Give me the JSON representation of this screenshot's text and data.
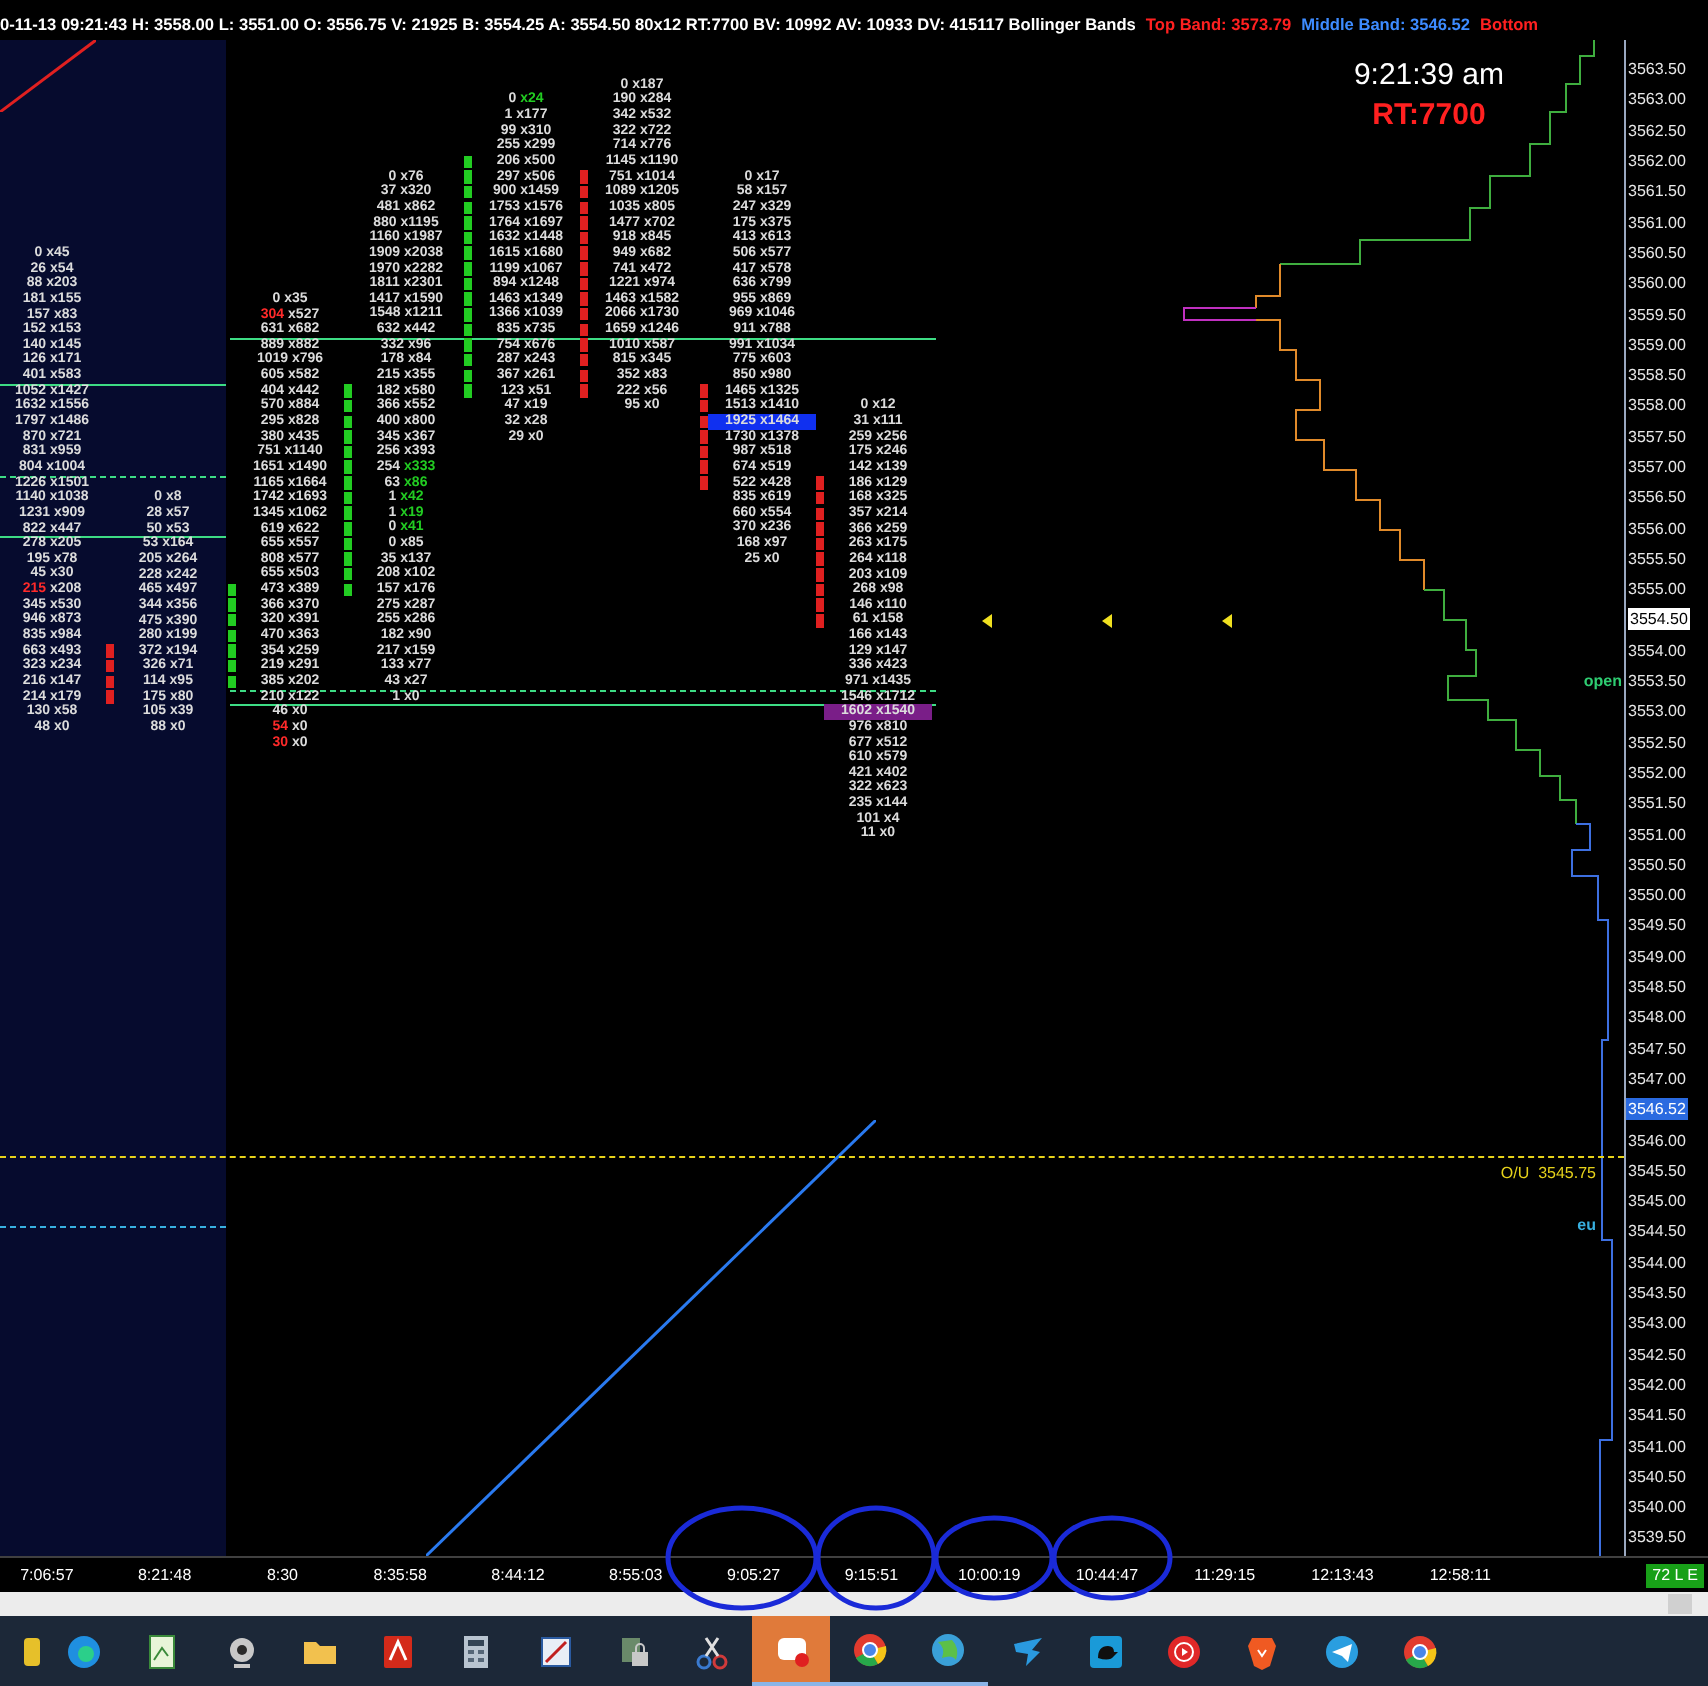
{
  "header": {
    "status": "0-11-13 09:21:43 H: 3558.00 L: 3551.00 O: 3556.75 V: 21925 B: 3554.25 A: 3554.50 80x12 RT:7700 BV: 10992 AV: 10933 DV: 415117 Bollinger Bands",
    "bands": [
      {
        "text": "Top Band: 3573.79",
        "color": "#ff2020"
      },
      {
        "text": "Middle Band: 3546.52",
        "color": "#3d8bff"
      },
      {
        "text": "Bottom",
        "color": "#ff2020"
      }
    ]
  },
  "clock": "9:21:39 am",
  "rt": "RT:7700",
  "footprint": {
    "columns": [
      {
        "rows": [
          {
            "bid": "0",
            "ask": "x45",
            "kind": "plain",
            "bar": false
          },
          {
            "bid": "26",
            "ask": "x54",
            "kind": "plain",
            "bar": false
          },
          {
            "bid": "88",
            "ask": "x203",
            "kind": "plain",
            "bar": false
          },
          {
            "bid": "181",
            "ask": "x155",
            "kind": "plain",
            "bar": false
          },
          {
            "bid": "157",
            "ask": "x83",
            "kind": "plain",
            "bar": false
          },
          {
            "bid": "152",
            "ask": "x153",
            "kind": "plain",
            "bar": false
          },
          {
            "bid": "140",
            "ask": "x145",
            "kind": "plain",
            "bar": false
          },
          {
            "bid": "126",
            "ask": "x171",
            "kind": "plain",
            "bar": false
          },
          {
            "bid": "401",
            "ask": "x583",
            "kind": "plain",
            "bar": false
          },
          {
            "bid": "1052",
            "ask": "x1427",
            "kind": "plain",
            "bar": false
          },
          {
            "bid": "1632",
            "ask": "x1556",
            "kind": "plain",
            "bar": false
          },
          {
            "bid": "1797",
            "ask": "x1486",
            "kind": "plain",
            "bar": false
          },
          {
            "bid": "870",
            "ask": "x721",
            "kind": "plain",
            "bar": false
          },
          {
            "bid": "831",
            "ask": "x959",
            "kind": "plain",
            "bar": false
          },
          {
            "bid": "804",
            "ask": "x1004",
            "kind": "plain",
            "bar": false
          },
          {
            "bid": "1226",
            "ask": "x1501",
            "kind": "plain",
            "bar": false
          },
          {
            "bid": "1140",
            "ask": "x1038",
            "kind": "plain",
            "bar": false
          },
          {
            "bid": "1231",
            "ask": "x909",
            "kind": "plain",
            "bar": false
          },
          {
            "bid": "822",
            "ask": "x447",
            "kind": "plain",
            "bar": false
          },
          {
            "bid": "278",
            "ask": "x205",
            "kind": "plain",
            "bar": false
          },
          {
            "bid": "195",
            "ask": "x78",
            "kind": "plain",
            "bar": false
          },
          {
            "bid": "45",
            "ask": "x30",
            "kind": "plain",
            "bar": false
          },
          {
            "bid": "215",
            "ask": "x208",
            "kind": "red-bid",
            "bar": false
          },
          {
            "bid": "345",
            "ask": "x530",
            "kind": "plain",
            "bar": false
          },
          {
            "bid": "946",
            "ask": "x873",
            "kind": "plain",
            "bar": false
          },
          {
            "bid": "835",
            "ask": "x984",
            "kind": "plain",
            "bar": false
          },
          {
            "bid": "663",
            "ask": "x493",
            "kind": "plain",
            "bar": false
          },
          {
            "bid": "323",
            "ask": "x234",
            "kind": "plain",
            "bar": false
          },
          {
            "bid": "216",
            "ask": "x147",
            "kind": "plain",
            "bar": false
          },
          {
            "bid": "214",
            "ask": "x179",
            "kind": "plain",
            "bar": false
          },
          {
            "bid": "130",
            "ask": "x58",
            "kind": "plain",
            "bar": false
          },
          {
            "bid": "48",
            "ask": "x0",
            "kind": "plain",
            "bar": false
          }
        ]
      },
      {
        "color": "#e02020",
        "rows": [
          {
            "bid": "0",
            "ask": "x8",
            "kind": "plain",
            "bar": false
          },
          {
            "bid": "28",
            "ask": "x57",
            "kind": "plain",
            "bar": false
          },
          {
            "bid": "50",
            "ask": "x53",
            "kind": "plain",
            "bar": false
          },
          {
            "bid": "53",
            "ask": "x164",
            "kind": "plain",
            "bar": false
          },
          {
            "bid": "205",
            "ask": "x264",
            "kind": "plain",
            "bar": false
          },
          {
            "bid": "228",
            "ask": "x242",
            "kind": "plain",
            "bar": false
          },
          {
            "bid": "465",
            "ask": "x497",
            "kind": "plain",
            "bar": false
          },
          {
            "bid": "344",
            "ask": "x356",
            "kind": "plain",
            "bar": false
          },
          {
            "bid": "475",
            "ask": "x390",
            "kind": "plain",
            "bar": false
          },
          {
            "bid": "280",
            "ask": "x199",
            "kind": "plain",
            "bar": false
          },
          {
            "bid": "372",
            "ask": "x194",
            "kind": "plain",
            "bar": true
          },
          {
            "bid": "326",
            "ask": "x71",
            "kind": "plain",
            "bar": true
          },
          {
            "bid": "114",
            "ask": "x95",
            "kind": "plain",
            "bar": true
          },
          {
            "bid": "175",
            "ask": "x80",
            "kind": "plain",
            "bar": true
          },
          {
            "bid": "105",
            "ask": "x39",
            "kind": "plain",
            "bar": false
          },
          {
            "bid": "88",
            "ask": "x0",
            "kind": "plain",
            "bar": false
          }
        ]
      },
      {
        "color": "#22cc22",
        "rows": [
          {
            "bid": "0",
            "ask": "x35",
            "kind": "plain",
            "bar": false
          },
          {
            "bid": "304",
            "ask": "x527",
            "kind": "red-bid",
            "bar": false
          },
          {
            "bid": "631",
            "ask": "x682",
            "kind": "plain",
            "bar": false
          },
          {
            "bid": "889",
            "ask": "x882",
            "kind": "plain",
            "bar": false
          },
          {
            "bid": "1019",
            "ask": "x796",
            "kind": "plain",
            "bar": false
          },
          {
            "bid": "605",
            "ask": "x582",
            "kind": "plain",
            "bar": false
          },
          {
            "bid": "404",
            "ask": "x442",
            "kind": "plain",
            "bar": false
          },
          {
            "bid": "570",
            "ask": "x884",
            "kind": "plain",
            "bar": false
          },
          {
            "bid": "295",
            "ask": "x828",
            "kind": "plain",
            "bar": false
          },
          {
            "bid": "380",
            "ask": "x435",
            "kind": "plain",
            "bar": false
          },
          {
            "bid": "751",
            "ask": "x1140",
            "kind": "plain",
            "bar": false
          },
          {
            "bid": "1651",
            "ask": "x1490",
            "kind": "plain",
            "bar": false
          },
          {
            "bid": "1165",
            "ask": "x1664",
            "kind": "plain",
            "bar": false
          },
          {
            "bid": "1742",
            "ask": "x1693",
            "kind": "plain",
            "bar": false
          },
          {
            "bid": "1345",
            "ask": "x1062",
            "kind": "plain",
            "bar": false
          },
          {
            "bid": "619",
            "ask": "x622",
            "kind": "plain",
            "bar": false
          },
          {
            "bid": "655",
            "ask": "x557",
            "kind": "plain",
            "bar": false
          },
          {
            "bid": "808",
            "ask": "x577",
            "kind": "plain",
            "bar": false
          },
          {
            "bid": "655",
            "ask": "x503",
            "kind": "plain",
            "bar": false
          },
          {
            "bid": "473",
            "ask": "x389",
            "kind": "plain",
            "bar": true
          },
          {
            "bid": "366",
            "ask": "x370",
            "kind": "plain",
            "bar": true
          },
          {
            "bid": "320",
            "ask": "x391",
            "kind": "plain",
            "bar": true
          },
          {
            "bid": "470",
            "ask": "x363",
            "kind": "plain",
            "bar": true
          },
          {
            "bid": "354",
            "ask": "x259",
            "kind": "plain",
            "bar": true
          },
          {
            "bid": "219",
            "ask": "x291",
            "kind": "plain",
            "bar": true
          },
          {
            "bid": "385",
            "ask": "x202",
            "kind": "plain",
            "bar": true
          },
          {
            "bid": "210",
            "ask": "x122",
            "kind": "plain",
            "bar": false
          },
          {
            "bid": "46",
            "ask": "x0",
            "kind": "plain",
            "bar": false
          },
          {
            "bid": "54",
            "ask": "x0",
            "kind": "red-bid",
            "bar": false
          },
          {
            "bid": "30",
            "ask": "x0",
            "kind": "red-bid",
            "bar": false
          }
        ]
      },
      {
        "color": "#22cc22",
        "rows": [
          {
            "bid": "0",
            "ask": "x76",
            "kind": "plain",
            "bar": false
          },
          {
            "bid": "37",
            "ask": "x320",
            "kind": "plain",
            "bar": false
          },
          {
            "bid": "481",
            "ask": "x862",
            "kind": "plain",
            "bar": false
          },
          {
            "bid": "880",
            "ask": "x1195",
            "kind": "plain",
            "bar": false
          },
          {
            "bid": "1160",
            "ask": "x1987",
            "kind": "plain",
            "bar": false
          },
          {
            "bid": "1909",
            "ask": "x2038",
            "kind": "plain",
            "bar": false
          },
          {
            "bid": "1970",
            "ask": "x2282",
            "kind": "plain",
            "bar": false
          },
          {
            "bid": "1811",
            "ask": "x2301",
            "kind": "plain",
            "bar": false
          },
          {
            "bid": "1417",
            "ask": "x1590",
            "kind": "plain",
            "bar": false
          },
          {
            "bid": "1548",
            "ask": "x1211",
            "kind": "plain",
            "bar": false
          },
          {
            "bid": "632",
            "ask": "x442",
            "kind": "plain",
            "bar": false
          },
          {
            "bid": "332",
            "ask": "x96",
            "kind": "plain",
            "bar": false
          },
          {
            "bid": "178",
            "ask": "x84",
            "kind": "plain",
            "bar": false
          },
          {
            "bid": "215",
            "ask": "x355",
            "kind": "plain",
            "bar": false
          },
          {
            "bid": "182",
            "ask": "x580",
            "kind": "plain",
            "bar": true
          },
          {
            "bid": "366",
            "ask": "x552",
            "kind": "plain",
            "bar": true
          },
          {
            "bid": "400",
            "ask": "x800",
            "kind": "plain",
            "bar": true
          },
          {
            "bid": "345",
            "ask": "x367",
            "kind": "plain",
            "bar": true
          },
          {
            "bid": "256",
            "ask": "x393",
            "kind": "plain",
            "bar": true
          },
          {
            "bid": "254",
            "ask": "x333",
            "kind": "green-ask",
            "bar": true
          },
          {
            "bid": "63",
            "ask": "x86",
            "kind": "green-ask",
            "bar": true
          },
          {
            "bid": "1",
            "ask": "x42",
            "kind": "green-ask",
            "bar": true
          },
          {
            "bid": "1",
            "ask": "x19",
            "kind": "green-ask",
            "bar": true
          },
          {
            "bid": "0",
            "ask": "x41",
            "kind": "green-ask",
            "bar": true
          },
          {
            "bid": "0",
            "ask": "x85",
            "kind": "plain",
            "bar": true
          },
          {
            "bid": "35",
            "ask": "x137",
            "kind": "plain",
            "bar": true
          },
          {
            "bid": "208",
            "ask": "x102",
            "kind": "plain",
            "bar": true
          },
          {
            "bid": "157",
            "ask": "x176",
            "kind": "plain",
            "bar": true
          },
          {
            "bid": "275",
            "ask": "x287",
            "kind": "plain",
            "bar": false
          },
          {
            "bid": "255",
            "ask": "x286",
            "kind": "plain",
            "bar": false
          },
          {
            "bid": "182",
            "ask": "x90",
            "kind": "plain",
            "bar": false
          },
          {
            "bid": "217",
            "ask": "x159",
            "kind": "plain",
            "bar": false
          },
          {
            "bid": "133",
            "ask": "x77",
            "kind": "plain",
            "bar": false
          },
          {
            "bid": "43",
            "ask": "x27",
            "kind": "plain",
            "bar": false
          },
          {
            "bid": "1",
            "ask": "x0",
            "kind": "plain",
            "bar": false
          }
        ]
      },
      {
        "color": "#22cc22",
        "rows": [
          {
            "bid": "0",
            "ask": "x24",
            "kind": "green-ask",
            "bar": false
          },
          {
            "bid": "1",
            "ask": "x177",
            "kind": "plain",
            "bar": false
          },
          {
            "bid": "99",
            "ask": "x310",
            "kind": "plain",
            "bar": false
          },
          {
            "bid": "255",
            "ask": "x299",
            "kind": "plain",
            "bar": false
          },
          {
            "bid": "206",
            "ask": "x500",
            "kind": "plain",
            "bar": true
          },
          {
            "bid": "297",
            "ask": "x506",
            "kind": "plain",
            "bar": true
          },
          {
            "bid": "900",
            "ask": "x1459",
            "kind": "plain",
            "bar": true
          },
          {
            "bid": "1753",
            "ask": "x1576",
            "kind": "plain",
            "bar": true
          },
          {
            "bid": "1764",
            "ask": "x1697",
            "kind": "plain",
            "bar": true
          },
          {
            "bid": "1632",
            "ask": "x1448",
            "kind": "plain",
            "bar": true
          },
          {
            "bid": "1615",
            "ask": "x1680",
            "kind": "plain",
            "bar": true
          },
          {
            "bid": "1199",
            "ask": "x1067",
            "kind": "plain",
            "bar": true
          },
          {
            "bid": "894",
            "ask": "x1248",
            "kind": "plain",
            "bar": true
          },
          {
            "bid": "1463",
            "ask": "x1349",
            "kind": "plain",
            "bar": true
          },
          {
            "bid": "1366",
            "ask": "x1039",
            "kind": "plain",
            "bar": true
          },
          {
            "bid": "835",
            "ask": "x735",
            "kind": "plain",
            "bar": true
          },
          {
            "bid": "754",
            "ask": "x676",
            "kind": "plain",
            "bar": true
          },
          {
            "bid": "287",
            "ask": "x243",
            "kind": "plain",
            "bar": true
          },
          {
            "bid": "367",
            "ask": "x261",
            "kind": "plain",
            "bar": true
          },
          {
            "bid": "123",
            "ask": "x51",
            "kind": "plain",
            "bar": true
          },
          {
            "bid": "47",
            "ask": "x19",
            "kind": "plain",
            "bar": false
          },
          {
            "bid": "32",
            "ask": "x28",
            "kind": "plain",
            "bar": false
          },
          {
            "bid": "29",
            "ask": "x0",
            "kind": "plain",
            "bar": false
          }
        ]
      },
      {
        "color": "#e02020",
        "rows": [
          {
            "bid": "0",
            "ask": "x187",
            "kind": "plain",
            "bar": false
          },
          {
            "bid": "190",
            "ask": "x284",
            "kind": "plain",
            "bar": false
          },
          {
            "bid": "342",
            "ask": "x532",
            "kind": "plain",
            "bar": false
          },
          {
            "bid": "322",
            "ask": "x722",
            "kind": "plain",
            "bar": false
          },
          {
            "bid": "714",
            "ask": "x776",
            "kind": "plain",
            "bar": false
          },
          {
            "bid": "1145",
            "ask": "x1190",
            "kind": "plain",
            "bar": false
          },
          {
            "bid": "751",
            "ask": "x1014",
            "kind": "plain",
            "bar": true
          },
          {
            "bid": "1089",
            "ask": "x1205",
            "kind": "plain",
            "bar": true
          },
          {
            "bid": "1035",
            "ask": "x805",
            "kind": "plain",
            "bar": true
          },
          {
            "bid": "1477",
            "ask": "x702",
            "kind": "plain",
            "bar": true
          },
          {
            "bid": "918",
            "ask": "x845",
            "kind": "plain",
            "bar": true
          },
          {
            "bid": "949",
            "ask": "x682",
            "kind": "plain",
            "bar": true
          },
          {
            "bid": "741",
            "ask": "x472",
            "kind": "plain",
            "bar": true
          },
          {
            "bid": "1221",
            "ask": "x974",
            "kind": "plain",
            "bar": true
          },
          {
            "bid": "1463",
            "ask": "x1582",
            "kind": "plain",
            "bar": true
          },
          {
            "bid": "2066",
            "ask": "x1730",
            "kind": "plain",
            "bar": true
          },
          {
            "bid": "1659",
            "ask": "x1246",
            "kind": "plain",
            "bar": true
          },
          {
            "bid": "1010",
            "ask": "x587",
            "kind": "plain",
            "bar": true
          },
          {
            "bid": "815",
            "ask": "x345",
            "kind": "plain",
            "bar": true
          },
          {
            "bid": "352",
            "ask": "x83",
            "kind": "plain",
            "bar": true
          },
          {
            "bid": "222",
            "ask": "x56",
            "kind": "plain",
            "bar": true
          },
          {
            "bid": "95",
            "ask": "x0",
            "kind": "plain",
            "bar": false
          }
        ]
      },
      {
        "color": "#e02020",
        "rows": [
          {
            "bid": "0",
            "ask": "x17",
            "kind": "plain",
            "bar": false
          },
          {
            "bid": "58",
            "ask": "x157",
            "kind": "plain",
            "bar": false
          },
          {
            "bid": "247",
            "ask": "x329",
            "kind": "plain",
            "bar": false
          },
          {
            "bid": "175",
            "ask": "x375",
            "kind": "plain",
            "bar": false
          },
          {
            "bid": "413",
            "ask": "x613",
            "kind": "plain",
            "bar": false
          },
          {
            "bid": "506",
            "ask": "x577",
            "kind": "plain",
            "bar": false
          },
          {
            "bid": "417",
            "ask": "x578",
            "kind": "plain",
            "bar": false
          },
          {
            "bid": "636",
            "ask": "x799",
            "kind": "plain",
            "bar": false
          },
          {
            "bid": "955",
            "ask": "x869",
            "kind": "plain",
            "bar": false
          },
          {
            "bid": "969",
            "ask": "x1046",
            "kind": "plain",
            "bar": false
          },
          {
            "bid": "911",
            "ask": "x788",
            "kind": "plain",
            "bar": false
          },
          {
            "bid": "991",
            "ask": "x1034",
            "kind": "plain",
            "bar": false
          },
          {
            "bid": "775",
            "ask": "x603",
            "kind": "plain",
            "bar": false
          },
          {
            "bid": "850",
            "ask": "x980",
            "kind": "plain",
            "bar": false
          },
          {
            "bid": "1465",
            "ask": "x1325",
            "kind": "plain",
            "bar": true
          },
          {
            "bid": "1513",
            "ask": "x1410",
            "kind": "plain",
            "bar": true
          },
          {
            "bid": "1925",
            "ask": "x1464",
            "kind": "blue",
            "bar": true
          },
          {
            "bid": "1730",
            "ask": "x1378",
            "kind": "plain",
            "bar": true
          },
          {
            "bid": "987",
            "ask": "x518",
            "kind": "plain",
            "bar": true
          },
          {
            "bid": "674",
            "ask": "x519",
            "kind": "plain",
            "bar": true
          },
          {
            "bid": "522",
            "ask": "x428",
            "kind": "plain",
            "bar": true
          },
          {
            "bid": "835",
            "ask": "x619",
            "kind": "plain",
            "bar": false
          },
          {
            "bid": "660",
            "ask": "x554",
            "kind": "plain",
            "bar": false
          },
          {
            "bid": "370",
            "ask": "x236",
            "kind": "plain",
            "bar": false
          },
          {
            "bid": "168",
            "ask": "x97",
            "kind": "plain",
            "bar": false
          },
          {
            "bid": "25",
            "ask": "x0",
            "kind": "plain",
            "bar": false
          }
        ]
      },
      {
        "color": "#e02020",
        "rows": [
          {
            "bid": "0",
            "ask": "x12",
            "kind": "plain",
            "bar": false
          },
          {
            "bid": "31",
            "ask": "x111",
            "kind": "plain",
            "bar": false
          },
          {
            "bid": "259",
            "ask": "x256",
            "kind": "plain",
            "bar": false
          },
          {
            "bid": "175",
            "ask": "x246",
            "kind": "plain",
            "bar": false
          },
          {
            "bid": "142",
            "ask": "x139",
            "kind": "plain",
            "bar": false
          },
          {
            "bid": "186",
            "ask": "x129",
            "kind": "plain",
            "bar": true
          },
          {
            "bid": "168",
            "ask": "x325",
            "kind": "plain",
            "bar": true
          },
          {
            "bid": "357",
            "ask": "x214",
            "kind": "plain",
            "bar": true
          },
          {
            "bid": "366",
            "ask": "x259",
            "kind": "plain",
            "bar": true
          },
          {
            "bid": "263",
            "ask": "x175",
            "kind": "plain",
            "bar": true
          },
          {
            "bid": "264",
            "ask": "x118",
            "kind": "plain",
            "bar": true
          },
          {
            "bid": "203",
            "ask": "x109",
            "kind": "plain",
            "bar": true
          },
          {
            "bid": "268",
            "ask": "x98",
            "kind": "plain",
            "bar": true
          },
          {
            "bid": "146",
            "ask": "x110",
            "kind": "plain",
            "bar": true
          },
          {
            "bid": "61",
            "ask": "x158",
            "kind": "plain",
            "bar": true
          },
          {
            "bid": "166",
            "ask": "x143",
            "kind": "plain",
            "bar": false
          },
          {
            "bid": "129",
            "ask": "x147",
            "kind": "plain",
            "bar": false
          },
          {
            "bid": "336",
            "ask": "x423",
            "kind": "plain",
            "bar": false
          },
          {
            "bid": "971",
            "ask": "x1435",
            "kind": "plain",
            "bar": false
          },
          {
            "bid": "1546",
            "ask": "x1712",
            "kind": "plain",
            "bar": false
          },
          {
            "bid": "1602",
            "ask": "x1540",
            "kind": "purple",
            "bar": false
          },
          {
            "bid": "976",
            "ask": "x810",
            "kind": "plain",
            "bar": false
          },
          {
            "bid": "677",
            "ask": "x512",
            "kind": "plain",
            "bar": false
          },
          {
            "bid": "610",
            "ask": "x579",
            "kind": "plain",
            "bar": false
          },
          {
            "bid": "421",
            "ask": "x402",
            "kind": "plain",
            "bar": false
          },
          {
            "bid": "322",
            "ask": "x623",
            "kind": "plain",
            "bar": false
          },
          {
            "bid": "235",
            "ask": "x144",
            "kind": "plain",
            "bar": false
          },
          {
            "bid": "101",
            "ask": "x4",
            "kind": "plain",
            "bar": false
          },
          {
            "bid": "11",
            "ask": "x0",
            "kind": "plain",
            "bar": false
          }
        ]
      }
    ]
  },
  "price_axis": [
    {
      "text": "3563.50",
      "kind": "tick"
    },
    {
      "text": "3563.00",
      "kind": "tick"
    },
    {
      "text": "3562.50",
      "kind": "tick"
    },
    {
      "text": "3562.00",
      "kind": "tick"
    },
    {
      "text": "3561.50",
      "kind": "tick"
    },
    {
      "text": "3561.00",
      "kind": "tick"
    },
    {
      "text": "3560.50",
      "kind": "tick"
    },
    {
      "text": "3560.00",
      "kind": "tick"
    },
    {
      "text": "3559.50",
      "kind": "tick"
    },
    {
      "text": "3559.00",
      "kind": "tick"
    },
    {
      "text": "3558.50",
      "kind": "tick"
    },
    {
      "text": "3558.00",
      "kind": "tick"
    },
    {
      "text": "3557.50",
      "kind": "tick"
    },
    {
      "text": "3557.00",
      "kind": "tick"
    },
    {
      "text": "3556.50",
      "kind": "tick"
    },
    {
      "text": "3556.00",
      "kind": "tick"
    },
    {
      "text": "3555.50",
      "kind": "tick"
    },
    {
      "text": "3555.00",
      "kind": "tick"
    },
    {
      "text": "3554.50",
      "kind": "last"
    },
    {
      "text": "3554.00",
      "kind": "tick"
    },
    {
      "text": "3553.50",
      "kind": "tick"
    },
    {
      "text": "3553.00",
      "kind": "tick"
    },
    {
      "text": "3552.50",
      "kind": "tick"
    },
    {
      "text": "3552.00",
      "kind": "tick"
    },
    {
      "text": "3551.50",
      "kind": "tick"
    },
    {
      "text": "3551.00",
      "kind": "tick"
    },
    {
      "text": "3550.50",
      "kind": "tick"
    },
    {
      "text": "3550.00",
      "kind": "tick"
    },
    {
      "text": "3549.50",
      "kind": "tick"
    },
    {
      "text": "3549.00",
      "kind": "tick"
    },
    {
      "text": "3548.50",
      "kind": "tick"
    },
    {
      "text": "3548.00",
      "kind": "tick"
    },
    {
      "text": "3547.50",
      "kind": "tick"
    },
    {
      "text": "3547.00",
      "kind": "tick"
    },
    {
      "text": "3546.52",
      "kind": "band"
    },
    {
      "text": "3546.00",
      "kind": "tick"
    },
    {
      "text": "3545.50",
      "kind": "tick"
    },
    {
      "text": "3545.00",
      "kind": "tick"
    },
    {
      "text": "3544.50",
      "kind": "tick"
    },
    {
      "text": "3544.00",
      "kind": "tick"
    },
    {
      "text": "3543.50",
      "kind": "tick"
    },
    {
      "text": "3543.00",
      "kind": "tick"
    },
    {
      "text": "3542.50",
      "kind": "tick"
    },
    {
      "text": "3542.00",
      "kind": "tick"
    },
    {
      "text": "3541.50",
      "kind": "tick"
    },
    {
      "text": "3541.00",
      "kind": "tick"
    },
    {
      "text": "3540.50",
      "kind": "tick"
    },
    {
      "text": "3540.00",
      "kind": "tick"
    },
    {
      "text": "3539.50",
      "kind": "tick"
    }
  ],
  "chart_labels": [
    {
      "text": "open",
      "kind": "open"
    },
    {
      "text": "O/U  3545.75",
      "kind": "ou"
    },
    {
      "text": "eu",
      "kind": "eu"
    }
  ],
  "time_axis": [
    "7:06:57",
    "8:21:48",
    "8:30",
    "8:35:58",
    "8:44:12",
    "8:55:03",
    "9:05:27",
    "9:15:51",
    "10:00:19",
    "10:44:47",
    "11:29:15",
    "12:13:43",
    "12:58:11"
  ],
  "badge": "72 L E",
  "taskbar": [
    {
      "selected": false,
      "running": false
    },
    {
      "selected": false,
      "running": false
    },
    {
      "selected": false,
      "running": false
    },
    {
      "selected": false,
      "running": false
    },
    {
      "selected": false,
      "running": false
    },
    {
      "selected": false,
      "running": false
    },
    {
      "selected": false,
      "running": false
    },
    {
      "selected": false,
      "running": false
    },
    {
      "selected": false,
      "running": false
    },
    {
      "selected": false,
      "running": false
    },
    {
      "selected": true,
      "running": true
    },
    {
      "selected": false,
      "running": true
    },
    {
      "selected": false,
      "running": true
    },
    {
      "selected": false,
      "running": false
    },
    {
      "selected": false,
      "running": false
    },
    {
      "selected": false,
      "running": false
    },
    {
      "selected": false,
      "running": false
    },
    {
      "selected": false,
      "running": false
    },
    {
      "selected": false,
      "running": false
    }
  ]
}
